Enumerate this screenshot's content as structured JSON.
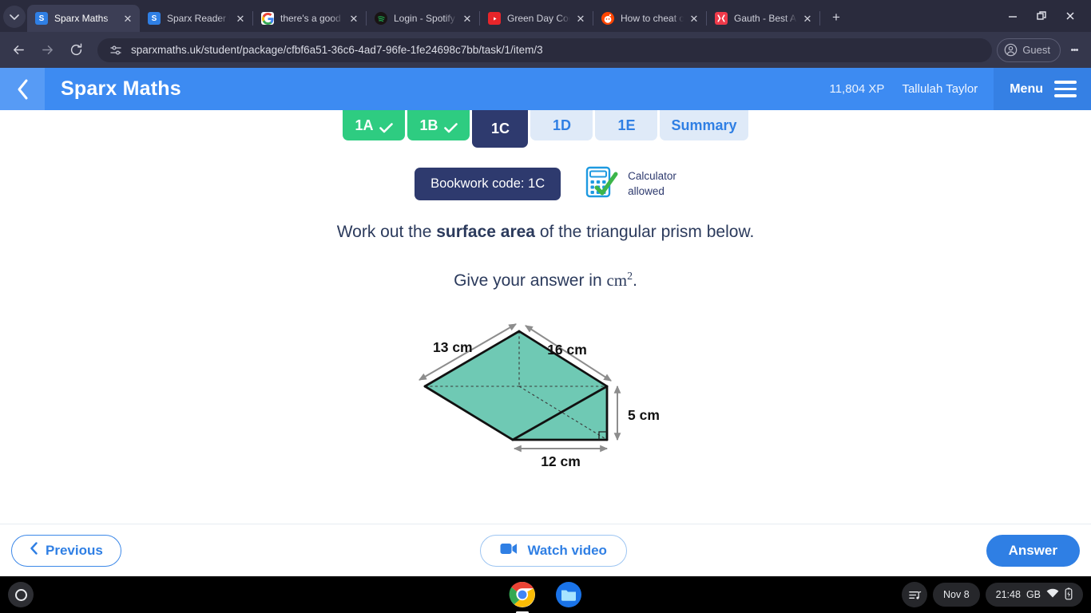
{
  "browser": {
    "tab_search_icon": "chevron-down-icon",
    "tabs": [
      {
        "title": "Sparx Maths",
        "favicon_letter": "S",
        "favicon_color": "#2f7fe4",
        "active": true
      },
      {
        "title": "Sparx Reader Log",
        "favicon_letter": "S",
        "favicon_color": "#2f7fe4",
        "active": false
      },
      {
        "title": "there's a good rea",
        "favicon_letter": "G",
        "favicon_color": "#ffffff",
        "active": false
      },
      {
        "title": "Login - Spotify",
        "favicon_letter": "",
        "favicon_color": "#1a1a1a",
        "active": false
      },
      {
        "title": "Green Day Cooks",
        "favicon_letter": "",
        "favicon_color": "#e8252a",
        "active": false
      },
      {
        "title": "How to cheat on",
        "favicon_letter": "",
        "favicon_color": "#ff4500",
        "active": false
      },
      {
        "title": "Gauth - Best AI H",
        "favicon_letter": "",
        "favicon_color": "#ef3a4a",
        "active": false
      }
    ],
    "new_tab_label": "+",
    "close_label": "✕",
    "window_controls": {
      "minimize": "minimize-icon",
      "restore": "restore-icon",
      "close": "close-icon"
    },
    "nav": {
      "back": "back-arrow-icon",
      "forward": "forward-arrow-icon",
      "reload": "reload-icon"
    },
    "url": "sparxmaths.uk/student/package/cfbf6a51-36c6-4ad7-96fe-1fe24698c7bb/task/1/item/3",
    "site_icon": "page-settings-icon",
    "profile_label": "Guest",
    "profile_icon": "account-circle-icon",
    "menu_icon": "three-dot-menu-icon"
  },
  "app_header": {
    "back_icon": "chevron-left-icon",
    "title": "Sparx Maths",
    "xp": "11,804 XP",
    "user_name": "Tallulah Taylor",
    "menu_label": "Menu",
    "menu_icon": "hamburger-icon",
    "brand_color": "#3d8bf2"
  },
  "task_tabs": [
    {
      "label": "1A",
      "state": "done"
    },
    {
      "label": "1B",
      "state": "done"
    },
    {
      "label": "1C",
      "state": "current"
    },
    {
      "label": "1D",
      "state": "todo"
    },
    {
      "label": "1E",
      "state": "todo"
    },
    {
      "label": "Summary",
      "state": "todo"
    }
  ],
  "question": {
    "bookwork_code": "Bookwork code: 1C",
    "calculator_icon": "calculator-allowed-icon",
    "calculator_line1": "Calculator",
    "calculator_line2": "allowed",
    "prompt_part1": "Work out the ",
    "prompt_bold": "surface area",
    "prompt_part2": " of the triangular prism below.",
    "answer_units_part1": "Give your answer in ",
    "answer_units_math": "cm",
    "answer_units_sup": "2",
    "answer_units_part3": "."
  },
  "figure": {
    "name": "triangular-prism-diagram",
    "fill_color": "#6fc9b4",
    "stroke_color": "#111111",
    "labels": {
      "slant": "13 cm",
      "length": "16 cm",
      "height": "5 cm",
      "base": "12 cm"
    }
  },
  "footer": {
    "previous_label": "Previous",
    "previous_icon": "chevron-left-icon",
    "watch_video_label": "Watch video",
    "watch_video_icon": "video-camera-icon",
    "answer_label": "Answer"
  },
  "shelf": {
    "launcher_icon": "launcher-circle-icon",
    "apps": [
      {
        "name": "chrome-icon",
        "running": true
      },
      {
        "name": "files-icon",
        "running": false
      }
    ],
    "tray": {
      "media_icon": "media-playlist-icon",
      "date": "Nov 8",
      "time": "21:48",
      "keyboard_layout": "GB",
      "wifi_icon": "wifi-icon",
      "battery_icon": "battery-charging-icon"
    }
  }
}
